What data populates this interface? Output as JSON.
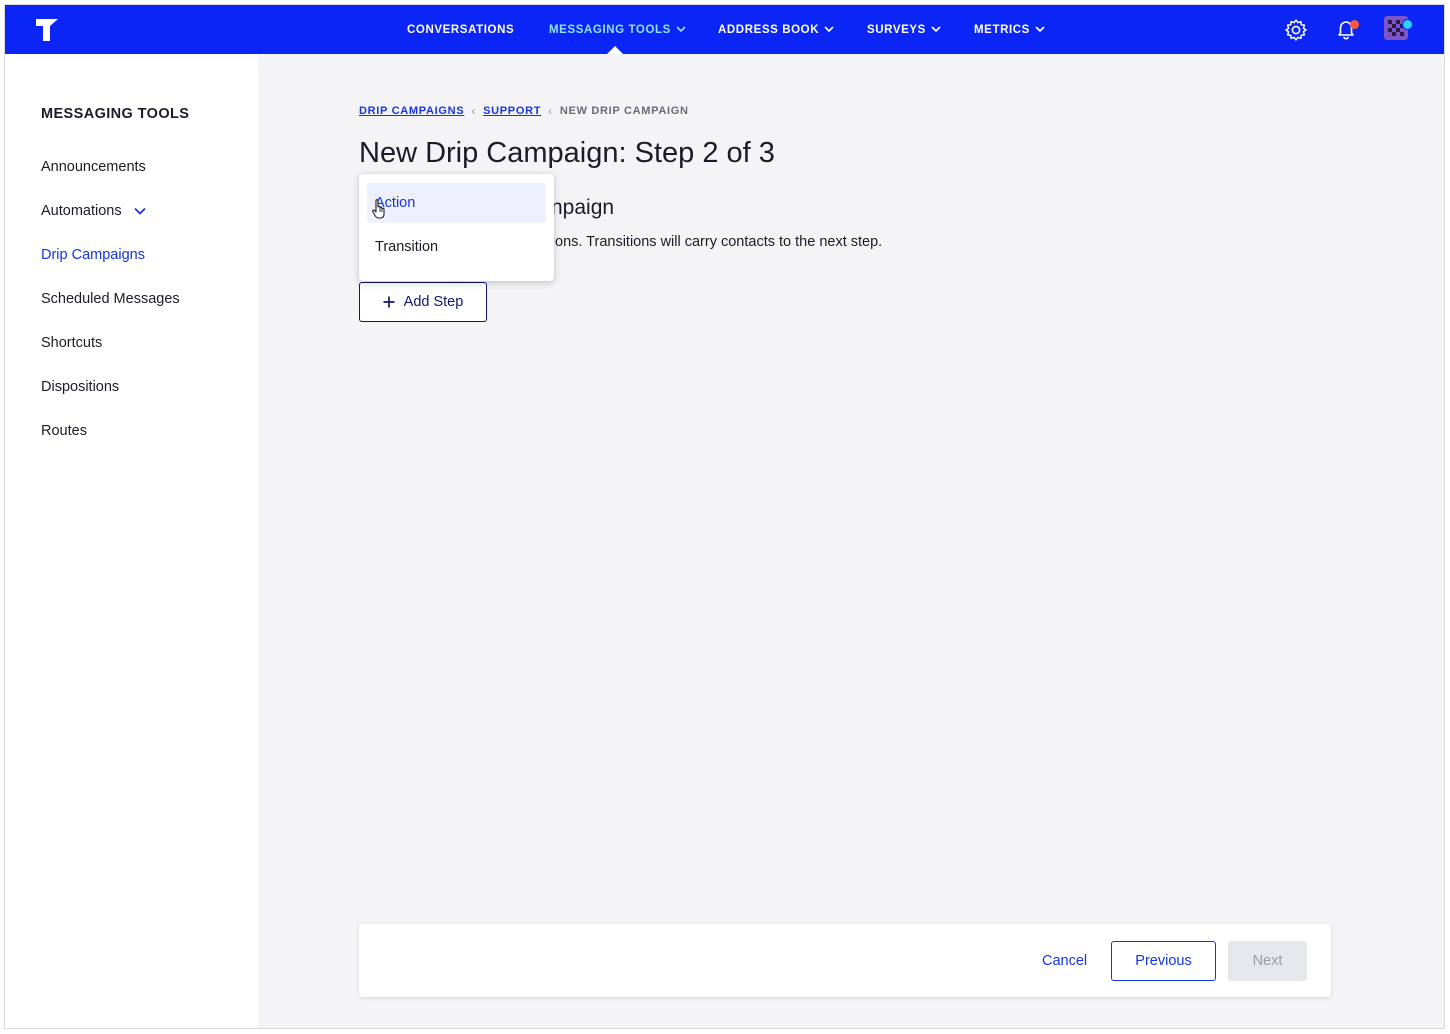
{
  "topbar": {
    "nav": [
      {
        "label": "CONVERSATIONS",
        "has_dropdown": false,
        "active": false
      },
      {
        "label": "MESSAGING TOOLS",
        "has_dropdown": true,
        "active": true
      },
      {
        "label": "ADDRESS BOOK",
        "has_dropdown": true,
        "active": false
      },
      {
        "label": "SURVEYS",
        "has_dropdown": true,
        "active": false
      },
      {
        "label": "METRICS",
        "has_dropdown": true,
        "active": false
      }
    ],
    "icons": [
      "logo-icon",
      "gear-icon",
      "bell-icon",
      "avatar"
    ]
  },
  "sidebar": {
    "title": "MESSAGING TOOLS",
    "items": [
      {
        "label": "Announcements"
      },
      {
        "label": "Automations",
        "expandable": true
      },
      {
        "label": "Drip Campaigns",
        "active": true
      },
      {
        "label": "Scheduled Messages"
      },
      {
        "label": "Shortcuts"
      },
      {
        "label": "Dispositions"
      },
      {
        "label": "Routes"
      }
    ]
  },
  "main": {
    "breadcrumb": [
      "DRIP CAMPAIGNS",
      "SUPPORT",
      "NEW DRIP CAMPAIGN"
    ],
    "title": "New Drip Campaign: Step 2 of 3",
    "section_title": "npaign",
    "section_desc": "ons. Transitions will carry contacts to the next step.",
    "add_step_label": "Add Step",
    "dropdown": {
      "items": [
        "Action",
        "Transition"
      ],
      "hovered": "Action"
    }
  },
  "footer": {
    "cancel_label": "Cancel",
    "previous_label": "Previous",
    "next_label": "Next"
  },
  "colors": {
    "topbar": "#0a25f5",
    "accent": "#1534e8",
    "active_nav": "#8fe3ff",
    "notification_dot": "#ff5a36",
    "avatar_dot": "#26d3ff"
  }
}
